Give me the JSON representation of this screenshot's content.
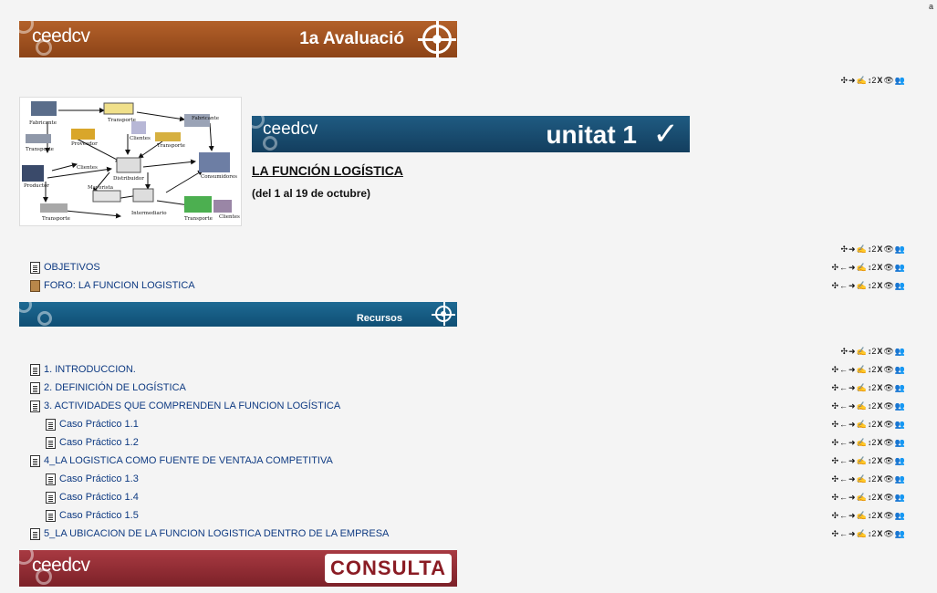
{
  "corner_mark": "a",
  "banners": {
    "evaluation": {
      "logo": "ceedcv",
      "title": "1a Avaluació"
    },
    "unit": {
      "logo": "ceedcv",
      "title": "unitat 1",
      "check": "✓"
    },
    "recursos": {
      "title": "Recursos"
    },
    "consulta": {
      "logo": "ceedcv",
      "badge": "CONSULTA"
    }
  },
  "unit": {
    "title": "LA FUNCIÓN LOGÍSTICA",
    "dates": "(del 1 al 19 de octubre)"
  },
  "diagram": {
    "nodes": {
      "fabricante1": "Fabricante",
      "transporte1": "Transporte",
      "fabricante2": "Fabricante",
      "proveedor": "Proveedor",
      "clientes1": "Clientes",
      "transporte2": "Transporte",
      "transporte3": "Transporte",
      "clientes2": "Clientes",
      "distribuidor": "Distribuidor",
      "consumidores": "Consumidores",
      "productor": "Productor",
      "mayorista": "Mayorista",
      "transporte4": "Transporte",
      "intermediario": "Intermediario",
      "transporte5": "Transporte",
      "clientes3": "Clientes"
    }
  },
  "controls": {
    "move": "✣",
    "left": "←",
    "right": "➜",
    "edit": "✍",
    "indent": "↕2",
    "delete": "X",
    "view": "👁",
    "groups": "👥"
  },
  "items_top": [
    {
      "label": "OBJETIVOS",
      "icon": "doc"
    },
    {
      "label": "FORO: LA FUNCION LOGISTICA",
      "icon": "forum"
    }
  ],
  "items_recursos": [
    {
      "label": "1. INTRODUCCION.",
      "sub": false
    },
    {
      "label": "2. DEFINICIÓN DE LOGÍSTICA",
      "sub": false
    },
    {
      "label": "3. ACTIVIDADES QUE COMPRENDEN LA FUNCION LOGÍSTICA",
      "sub": false
    },
    {
      "label": "Caso Práctico 1.1",
      "sub": true
    },
    {
      "label": "Caso Práctico 1.2",
      "sub": true
    },
    {
      "label": "4_LA LOGISTICA COMO FUENTE DE VENTAJA COMPETITIVA",
      "sub": false
    },
    {
      "label": "Caso Práctico 1.3",
      "sub": true
    },
    {
      "label": "Caso Práctico 1.4",
      "sub": true
    },
    {
      "label": "Caso Práctico 1.5",
      "sub": true
    },
    {
      "label": "5_LA UBICACION DE LA FUNCION LOGISTICA DENTRO DE LA EMPRESA",
      "sub": false
    }
  ]
}
